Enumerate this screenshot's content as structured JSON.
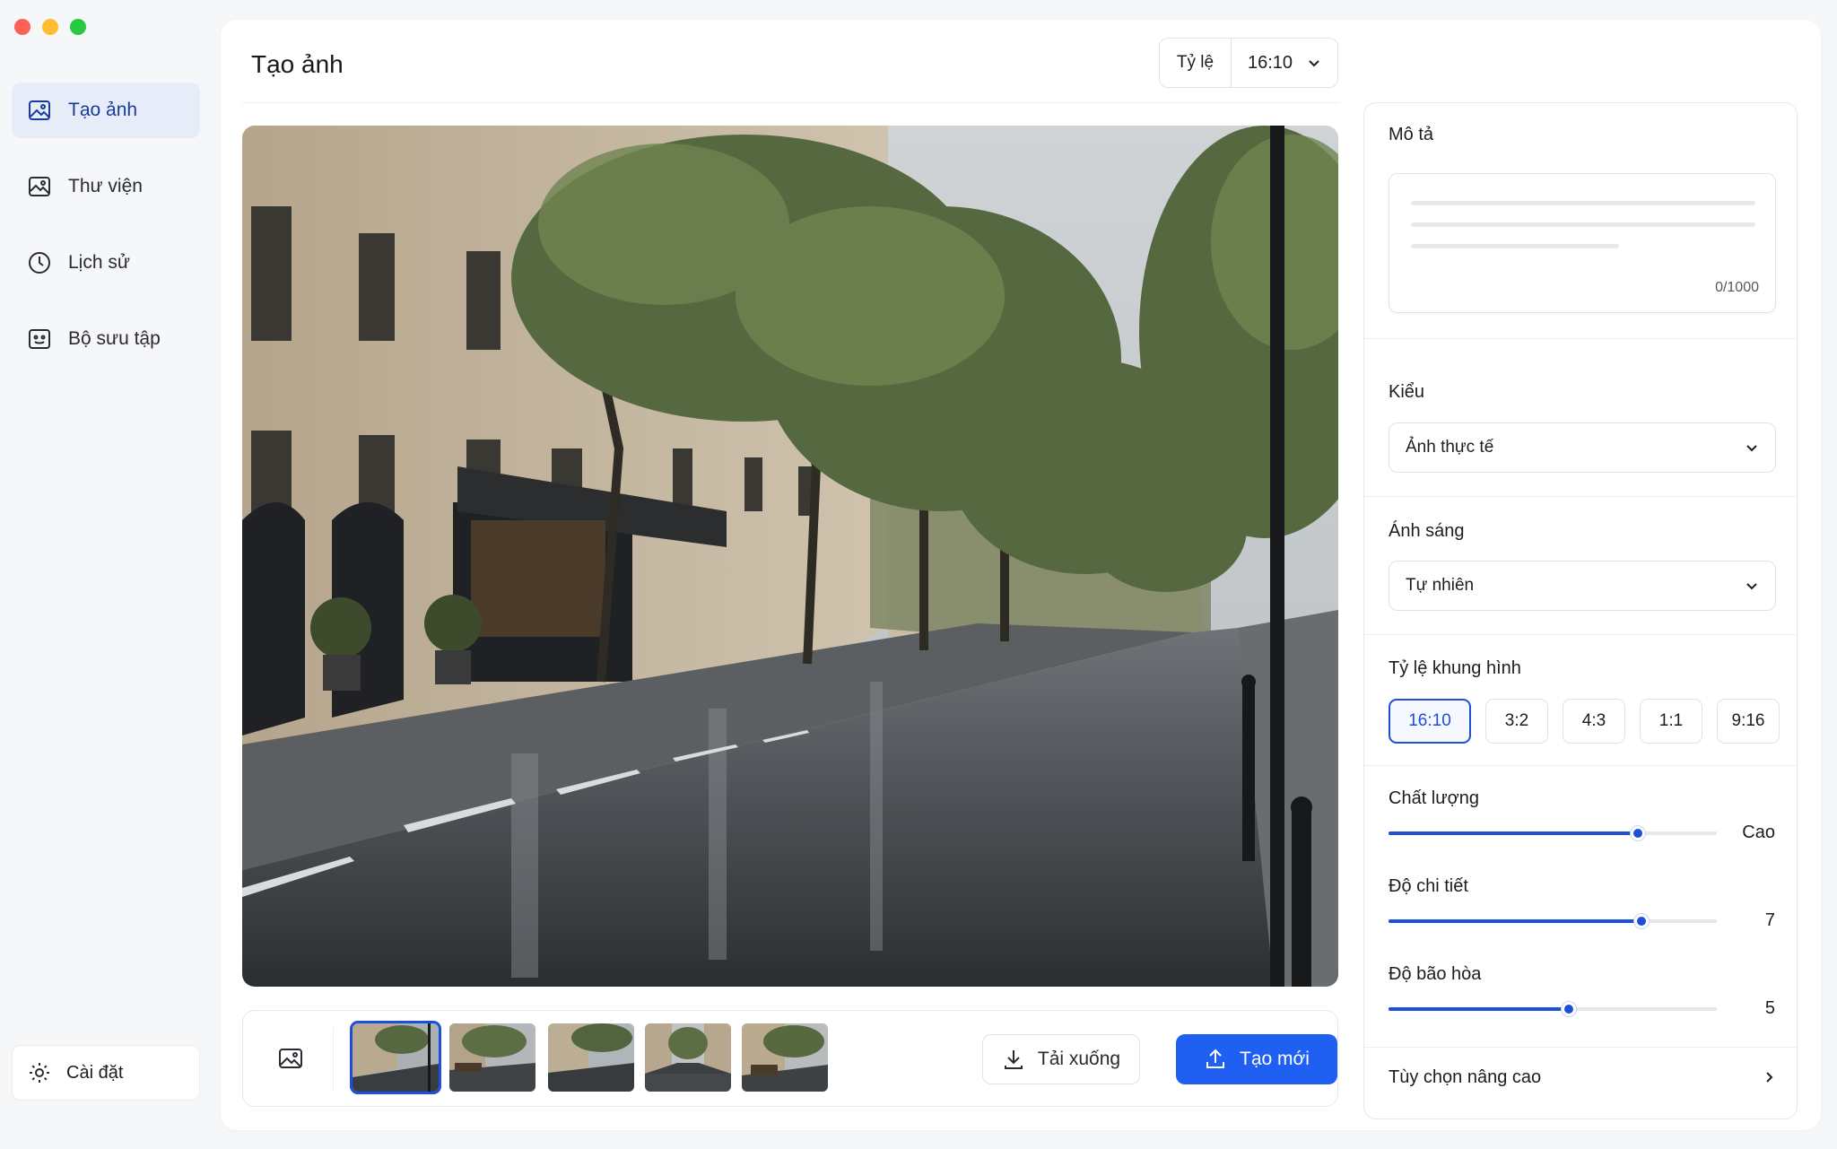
{
  "sidebar": {
    "items": [
      {
        "label": "Tạo ảnh",
        "icon": "image-icon",
        "active": true
      },
      {
        "label": "Thư viện",
        "icon": "gallery-icon",
        "active": false
      },
      {
        "label": "Lịch sử",
        "icon": "clock-icon",
        "active": false
      },
      {
        "label": "Bộ sưu tập",
        "icon": "collection-icon",
        "active": false
      }
    ],
    "settings_label": "Cài đặt"
  },
  "header": {
    "title": "Tạo ảnh",
    "ratio_label": "Tỷ lệ",
    "ratio_value": "16:10"
  },
  "actions": {
    "download_label": "Tải xuống",
    "create_new_label": "Tạo mới"
  },
  "thumbnails": {
    "count": 5,
    "selected_index": 0
  },
  "panel": {
    "description": {
      "label": "Mô tả",
      "counter": "0/1000"
    },
    "style": {
      "label": "Kiểu",
      "value": "Ảnh thực tế"
    },
    "lighting": {
      "label": "Ánh sáng",
      "value": "Tự nhiên"
    },
    "aspect": {
      "label": "Tỷ lệ khung hình",
      "options": [
        "16:10",
        "3:2",
        "4:3",
        "1:1",
        "9:16"
      ],
      "selected": "16:10"
    },
    "quality": {
      "label": "Chất lượng",
      "value_label": "Cao",
      "level": 0.76
    },
    "detail": {
      "label": "Độ chi tiết",
      "value_label": "7",
      "level": 0.77
    },
    "saturation": {
      "label": "Độ bão hòa",
      "value_label": "5",
      "level": 0.55
    },
    "advanced_label": "Tùy chọn nâng cao"
  },
  "colors": {
    "accent": "#1f5ff2",
    "active_nav_bg": "#e6edf9"
  }
}
